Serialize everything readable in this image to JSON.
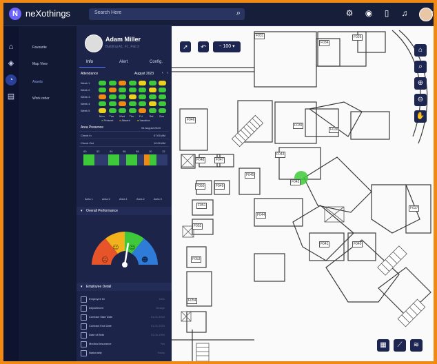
{
  "app": {
    "brand": "neXothings"
  },
  "topbar": {
    "search_placeholder": "Search Here",
    "icons": [
      "search-icon",
      "settings-icon",
      "eye-icon",
      "bookmark-icon",
      "bell-icon",
      "user-avatar",
      "chevron-down-icon"
    ]
  },
  "rail": {
    "icons": [
      "home-icon",
      "location-icon",
      "assets-icon",
      "workorder-icon"
    ]
  },
  "menu": {
    "items": [
      {
        "label": "Favourite"
      },
      {
        "label": "Map View"
      },
      {
        "label": "Assets"
      },
      {
        "label": "Work order"
      }
    ]
  },
  "profile": {
    "name": "Adam Miller",
    "subtitle": "Building A1, F1, Flat 2"
  },
  "tabs": [
    "Info",
    "Alert",
    "Config."
  ],
  "attendance": {
    "title": "Attendance",
    "month": "August 2023",
    "weeks": [
      "Week 1",
      "Week 2",
      "Week 3",
      "Week 4",
      "Week 5"
    ],
    "days": [
      "Mon",
      "Tue",
      "Wed",
      "Thu",
      "Fri",
      "Sat",
      "Sun"
    ],
    "grid": [
      [
        "present",
        "present",
        "absent",
        "present",
        "vacation",
        "present",
        "vacation"
      ],
      [
        "present",
        "absent",
        "present",
        "present",
        "present",
        "vacation",
        "present"
      ],
      [
        "absent",
        "present",
        "present",
        "vacation",
        "present",
        "present",
        "present"
      ],
      [
        "present",
        "present",
        "absent",
        "present",
        "present",
        "vacation",
        "present"
      ],
      [
        "vacation",
        "present",
        "present",
        "present",
        "absent",
        "present",
        "present"
      ]
    ],
    "legend": [
      "Present",
      "Absent",
      "Vacation"
    ],
    "colors": {
      "present": "#3ec93a",
      "absent": "#f08a12",
      "vacation": "#e9d11c"
    }
  },
  "area_presence": {
    "title": "Area Presence",
    "date": "04 August 2023",
    "check_in_label": "Check in",
    "check_in": "07:00 AM",
    "check_out_label": "Check Out",
    "check_out": "10:00 AM",
    "hours": [
      "00",
      "02",
      "04",
      "06",
      "08",
      "10",
      "12"
    ],
    "areas": [
      "Area 1",
      "Area 2",
      "Area 1",
      "Area 2",
      "Area 3"
    ]
  },
  "overall_performance": {
    "title": "Overall Performance",
    "score": 0.55,
    "bands": [
      "Bad",
      "Average",
      "Good",
      "Excellent"
    ]
  },
  "employee_detail": {
    "title": "Employee Detail",
    "rows": [
      {
        "label": "Employee ID",
        "value": "1001"
      },
      {
        "label": "Department",
        "value": "Design"
      },
      {
        "label": "Contract Start Date",
        "value": "01.01.2023"
      },
      {
        "label": "Contract End Date",
        "value": "01.01.2024"
      },
      {
        "label": "Date of Birth",
        "value": "01.05.1994"
      },
      {
        "label": "Medical Insurance",
        "value": "Yes"
      },
      {
        "label": "Nationality",
        "value": "Swiss"
      }
    ]
  },
  "map": {
    "zoom": "100",
    "rooms": [
      "F031",
      "F026",
      "F034",
      "F046",
      "F039",
      "F038",
      "F043",
      "F048",
      "F047",
      "F049",
      "F045",
      "F050",
      "F051",
      "F042",
      "F037",
      "F044",
      "F052",
      "F041",
      "F040",
      "F053",
      "F054"
    ]
  }
}
